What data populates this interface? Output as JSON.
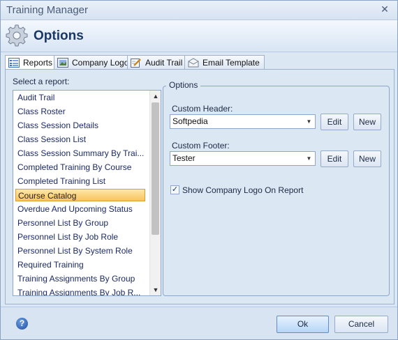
{
  "window": {
    "title": "Training Manager"
  },
  "header": {
    "title": "Options"
  },
  "tabs": [
    {
      "label": "Reports",
      "icon": "report-list-icon"
    },
    {
      "label": "Company Logo",
      "icon": "image-icon"
    },
    {
      "label": "Audit Trail",
      "icon": "pencil-note-icon"
    },
    {
      "label": "Email Template",
      "icon": "envelope-icon"
    }
  ],
  "reports": {
    "select_label": "Select a report:",
    "selected_index": 8,
    "items": [
      "Audit Trail",
      "Class Roster",
      "Class Session Details",
      "Class Session List",
      "Class Session Summary By Trai...",
      "Completed Training By Course",
      "Completed Training List",
      "Course Catalog",
      "Overdue And Upcoming Status",
      "Personnel List By Group",
      "Personnel List By Job Role",
      "Personnel List By System Role",
      "Required Training",
      "Training Assignments By Group",
      "Training Assignments By Job R..."
    ]
  },
  "options": {
    "group_title": "Options",
    "header_label": "Custom Header:",
    "header_value": "Softpedia",
    "footer_label": "Custom Footer:",
    "footer_value": "Tester",
    "edit_label": "Edit",
    "new_label": "New",
    "show_logo_label": "Show Company Logo On Report",
    "show_logo_checked": true
  },
  "footer": {
    "ok_label": "Ok",
    "cancel_label": "Cancel"
  }
}
